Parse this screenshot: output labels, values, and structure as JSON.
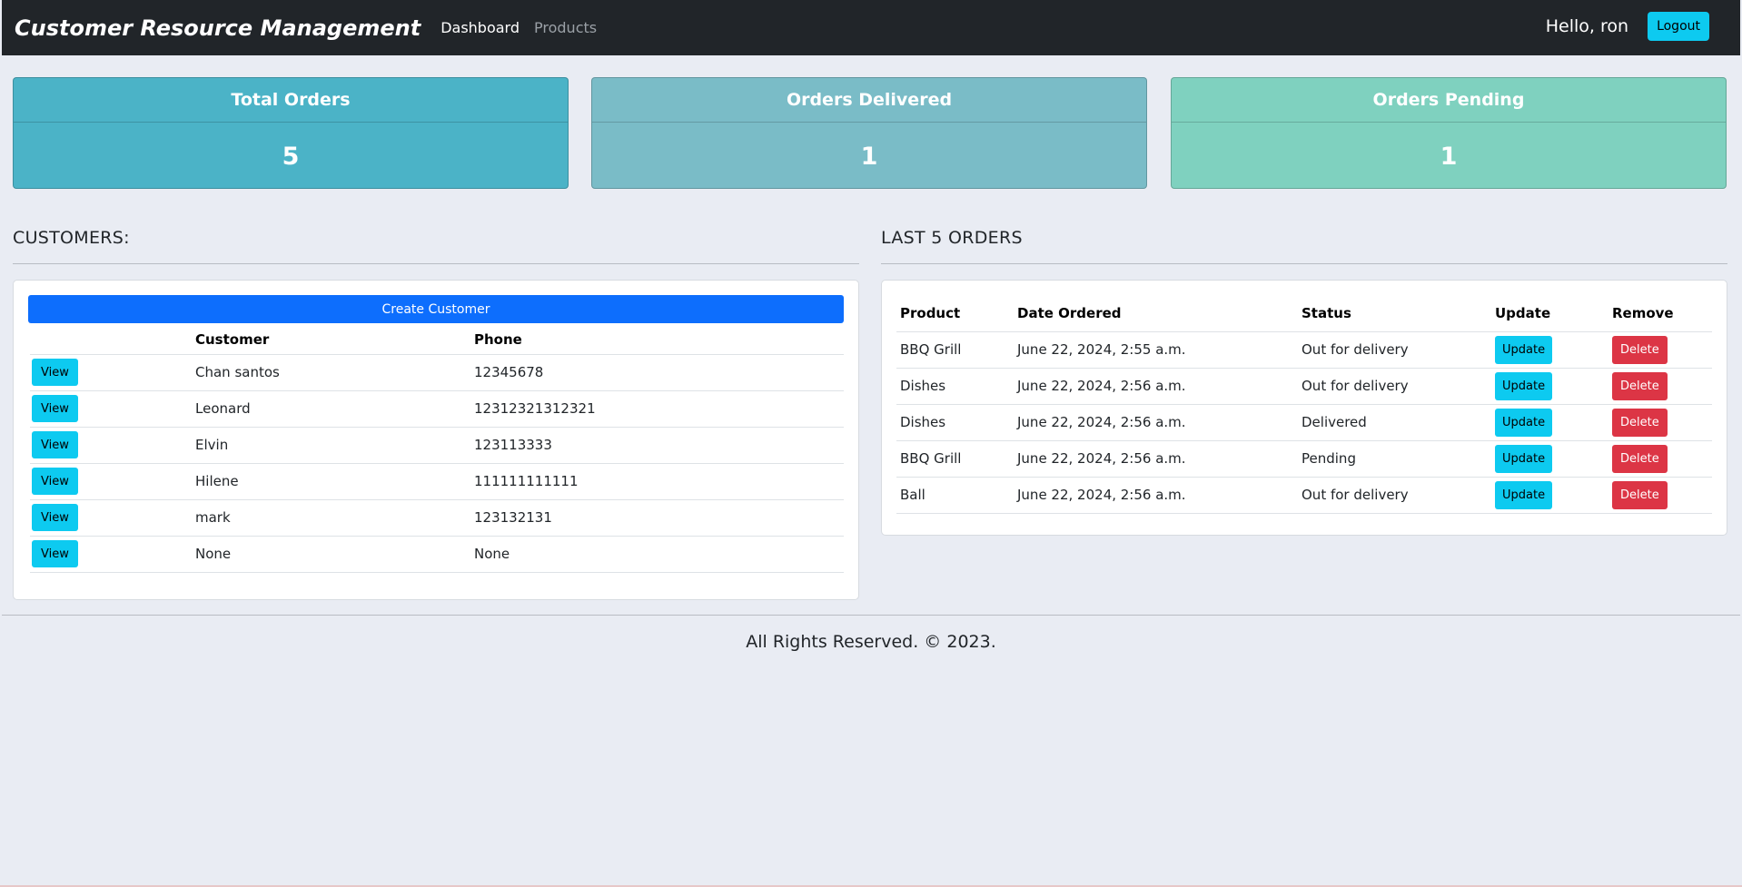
{
  "navbar": {
    "brand": "Customer Resource Management",
    "links": [
      {
        "label": "Dashboard",
        "active": true
      },
      {
        "label": "Products",
        "active": false
      }
    ],
    "greeting": "Hello, ron",
    "logout_label": "Logout"
  },
  "stats": [
    {
      "title": "Total Orders",
      "value": "5",
      "color": "#4bb3c7"
    },
    {
      "title": "Orders Delivered",
      "value": "1",
      "color": "#7abcc7"
    },
    {
      "title": "Orders Pending",
      "value": "1",
      "color": "#7fd1bf"
    }
  ],
  "customers": {
    "title": "CUSTOMERS:",
    "create_label": "Create Customer",
    "headers": [
      "",
      "Customer",
      "Phone"
    ],
    "view_label": "View",
    "rows": [
      {
        "name": "Chan santos",
        "phone": "12345678"
      },
      {
        "name": "Leonard",
        "phone": "12312321312321"
      },
      {
        "name": "Elvin",
        "phone": "123113333"
      },
      {
        "name": "Hilene",
        "phone": "111111111111"
      },
      {
        "name": "mark",
        "phone": "123132131"
      },
      {
        "name": "None",
        "phone": "None"
      }
    ]
  },
  "orders": {
    "title": "LAST 5 ORDERS",
    "headers": [
      "Product",
      "Date Ordered",
      "Status",
      "Update",
      "Remove"
    ],
    "update_label": "Update",
    "delete_label": "Delete",
    "rows": [
      {
        "product": "BBQ Grill",
        "date": "June 22, 2024, 2:55 a.m.",
        "status": "Out for delivery"
      },
      {
        "product": "Dishes",
        "date": "June 22, 2024, 2:56 a.m.",
        "status": "Out for delivery"
      },
      {
        "product": "Dishes",
        "date": "June 22, 2024, 2:56 a.m.",
        "status": "Delivered"
      },
      {
        "product": "BBQ Grill",
        "date": "June 22, 2024, 2:56 a.m.",
        "status": "Pending"
      },
      {
        "product": "Ball",
        "date": "June 22, 2024, 2:56 a.m.",
        "status": "Out for delivery"
      }
    ]
  },
  "footer": {
    "text": "All Rights Reserved. © 2023."
  }
}
